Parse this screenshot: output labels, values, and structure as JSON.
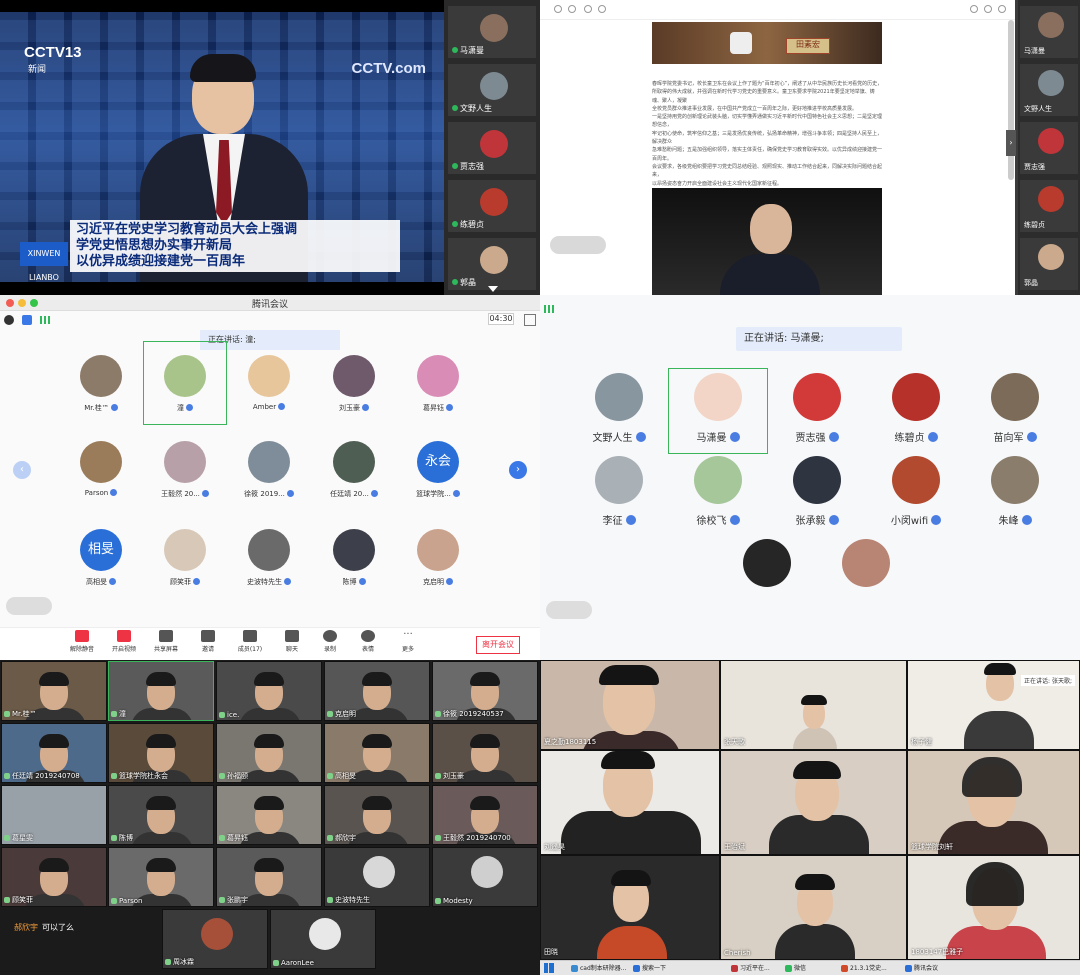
{
  "q1": {
    "tv": {
      "channel": "CCTV13",
      "channel_sub": "新闻",
      "watermark": "CCTV.com",
      "badge": "XINWEN LIANBO",
      "headline": [
        "习近平在党史学习教育动员大会上强调",
        "学党史悟思想办实事开新局",
        "以优异成绩迎接建党一百周年"
      ]
    },
    "sidebar": [
      {
        "name": "马潇曼",
        "color": "#8a6f5e"
      },
      {
        "name": "文野人生",
        "color": "#7d8a92"
      },
      {
        "name": "贾志强",
        "color": "#c0353a"
      },
      {
        "name": "练碧贞",
        "color": "#b83b2e"
      },
      {
        "name": "郭晶",
        "color": "#caa98d"
      }
    ]
  },
  "q2": {
    "name_card": "田素宏",
    "paragraph": [
      "春晖学院党委书记，校长童卫东在会议上作了题为“百年初心”，阐述了从中华民族历史长河看党的历史，",
      "所取得的伟大成就，并强调在新时代学习党史的重要意义。童卫东要求学院2021年要坚定地举旗、铸魂、聚人，凝聚",
      "全校党员群众推进事业发展，在中国共产党成立一百周年之际，更好地推进学校高质量发展。",
      "一是坚持用党的创新理论武装头脑，切实学懂弄通做实习近平新时代中国特色社会主义思想；二是坚定理想信念，",
      "牢记初心使命，筑牢信仰之基；三是发扬优良传统，弘扬革命精神，增强斗争本领；四是坚持人民至上，解决群众",
      "急难愁盼问题；五是加强组织领导，落实主体责任，确保党史学习教育取得实效。以优异成绩迎接建党一百周年。",
      "会议要求，各级党组织要把学习党史同总结经验、观照现实、推动工作结合起来，同解决实际问题结合起来，",
      "以昂扬姿态奋力开启全面建设社会主义现代化国家新征程。"
    ],
    "sidebar": [
      {
        "name": "马潇曼",
        "color": "#8a6f5e"
      },
      {
        "name": "文野人生",
        "color": "#7d8a92"
      },
      {
        "name": "贾志强",
        "color": "#c0353a"
      },
      {
        "name": "练碧贞",
        "color": "#b83b2e"
      },
      {
        "name": "郭晶",
        "color": "#caa98d"
      }
    ]
  },
  "q3": {
    "title": "腾讯会议",
    "timer": "04:30",
    "speaking": "正在讲话: 潼;",
    "rows": [
      [
        {
          "name": "Mr.桂™",
          "color": "#8d7b6a"
        },
        {
          "name": "潼",
          "color": "#a8c48a"
        },
        {
          "name": "Amber",
          "color": "#e8c69c"
        },
        {
          "name": "刘玉豪",
          "color": "#6f5a6b"
        },
        {
          "name": "葛昇钰",
          "color": "#d98db6"
        }
      ],
      [
        {
          "name": "Parson",
          "color": "#9a7c5a"
        },
        {
          "name": "王毅然 20...",
          "color": "#b7a0a8"
        },
        {
          "name": "徐筱 2019...",
          "color": "#7e8d99"
        },
        {
          "name": "任廷靖 20...",
          "color": "#4e5e52"
        },
        {
          "name": "篮球学院...",
          "color": "#2a6fd8",
          "text": "永会"
        }
      ],
      [
        {
          "name": "高相旻",
          "color": "#2a6fd8",
          "text": "相旻"
        },
        {
          "name": "顾笑菲",
          "color": "#d8c8b8"
        },
        {
          "name": "史波特先生",
          "color": "#6a6a6a"
        },
        {
          "name": "陈博",
          "color": "#3d3f4a"
        },
        {
          "name": "克启明",
          "color": "#c9a38d"
        }
      ]
    ],
    "toolbar": [
      {
        "label": "解除静音",
        "icon": "mic-icon"
      },
      {
        "label": "开启视频",
        "icon": "camera-icon"
      },
      {
        "label": "共享屏幕",
        "icon": "share-icon"
      },
      {
        "label": "邀请",
        "icon": "invite-icon"
      },
      {
        "label": "成员(17)",
        "icon": "members-icon"
      },
      {
        "label": "聊天",
        "icon": "chat-icon"
      },
      {
        "label": "录制",
        "icon": "record-icon"
      },
      {
        "label": "表情",
        "icon": "emoji-icon"
      },
      {
        "label": "更多",
        "icon": "more-icon"
      }
    ],
    "leave": "离开会议"
  },
  "q4": {
    "speaking": "正在讲话: 马潇曼;",
    "rows": [
      [
        {
          "name": "文野人生",
          "color": "#8896a0"
        },
        {
          "name": "马潇曼",
          "color": "#f2d5c6"
        },
        {
          "name": "贾志强",
          "color": "#d23a3a"
        },
        {
          "name": "练碧贞",
          "color": "#b5312a"
        },
        {
          "name": "苗向军",
          "color": "#7c6b58"
        }
      ],
      [
        {
          "name": "李征",
          "color": "#a9b0b6"
        },
        {
          "name": "徐校飞",
          "color": "#a6c79a"
        },
        {
          "name": "张承毅",
          "color": "#2f3540"
        },
        {
          "name": "小闵wifi",
          "color": "#b24a2f"
        },
        {
          "name": "朱峰",
          "color": "#8a7d6c"
        }
      ],
      [
        {
          "name": "",
          "color": "#262626"
        },
        {
          "name": "",
          "color": "#b88474"
        }
      ]
    ]
  },
  "q5": {
    "tiles": [
      {
        "name": "Mr.桂™",
        "bg": "#6b5a48"
      },
      {
        "name": "潼",
        "bg": "#5a5a5a",
        "active": true
      },
      {
        "name": "ice.",
        "bg": "#4a4a4a"
      },
      {
        "name": "克启明",
        "bg": "#565656"
      },
      {
        "name": "徐筱 2019240537",
        "bg": "#6a6a6a"
      },
      {
        "name": "任廷靖 2019240708",
        "bg": "#4e6a8a"
      },
      {
        "name": "篮球学院杜永会",
        "bg": "#5a4a3a"
      },
      {
        "name": "孙福颐",
        "bg": "#7a7670"
      },
      {
        "name": "高相旻",
        "bg": "#8a7a6a"
      },
      {
        "name": "刘玉豪",
        "bg": "#5a5048"
      },
      {
        "name": "葛星雯",
        "bg": "#98a0a8"
      },
      {
        "name": "陈博",
        "bg": "#4a4a4a"
      },
      {
        "name": "葛昇钰",
        "bg": "#8a8680"
      },
      {
        "name": "郝欣宇",
        "bg": "#5a5450"
      },
      {
        "name": "王毅然 2019240700",
        "bg": "#6a5a5a"
      },
      {
        "name": "顾笑菲",
        "bg": "#4a3a3a"
      },
      {
        "name": "Parson",
        "bg": "#6a6a6a"
      },
      {
        "name": "张鹏宇",
        "bg": "#5a5a5a"
      },
      {
        "name": "史波特先生",
        "bg": "#3a3a3a"
      },
      {
        "name": "Modesty",
        "bg": "#3a3a3a"
      },
      {
        "name": "周冰霖",
        "bg": "#3a3a3a"
      },
      {
        "name": "AaronLee",
        "bg": "#3a3a3a"
      }
    ],
    "chat": {
      "sender": "郝欣宇",
      "message": "可以了么"
    }
  },
  "q6": {
    "tiles": [
      {
        "name": "夏之勤1803115",
        "bg": "#c9b8aa"
      },
      {
        "name": "张天歌",
        "bg": "#e8e4dc"
      },
      {
        "name": "杨子健",
        "bg": "#f0ece6"
      },
      {
        "name": "刘遥昊",
        "bg": "#eceae6"
      },
      {
        "name": "王治斌",
        "bg": "#d8cec4"
      },
      {
        "name": "篮球学院刘轩",
        "bg": "#d6c8b8"
      },
      {
        "name": "田晓",
        "bg": "#2a2a2a"
      },
      {
        "name": "Cherish",
        "bg": "#d8d0c4"
      },
      {
        "name": "1803147巴雅子",
        "bg": "#e8e4de"
      }
    ],
    "speaker_tip": "正在讲话: 张天歌;",
    "taskbar": [
      {
        "label": "cad制本研除器...",
        "color": "#3a8ad0"
      },
      {
        "label": "搜索一下",
        "color": "#2a6fd8"
      },
      {
        "label": "习近平在...",
        "color": "#c0353a"
      },
      {
        "label": "微信",
        "color": "#2eb85c"
      },
      {
        "label": "21.3.1党史...",
        "color": "#d04a2a"
      },
      {
        "label": "腾讯会议",
        "color": "#2a6fd8"
      }
    ]
  }
}
